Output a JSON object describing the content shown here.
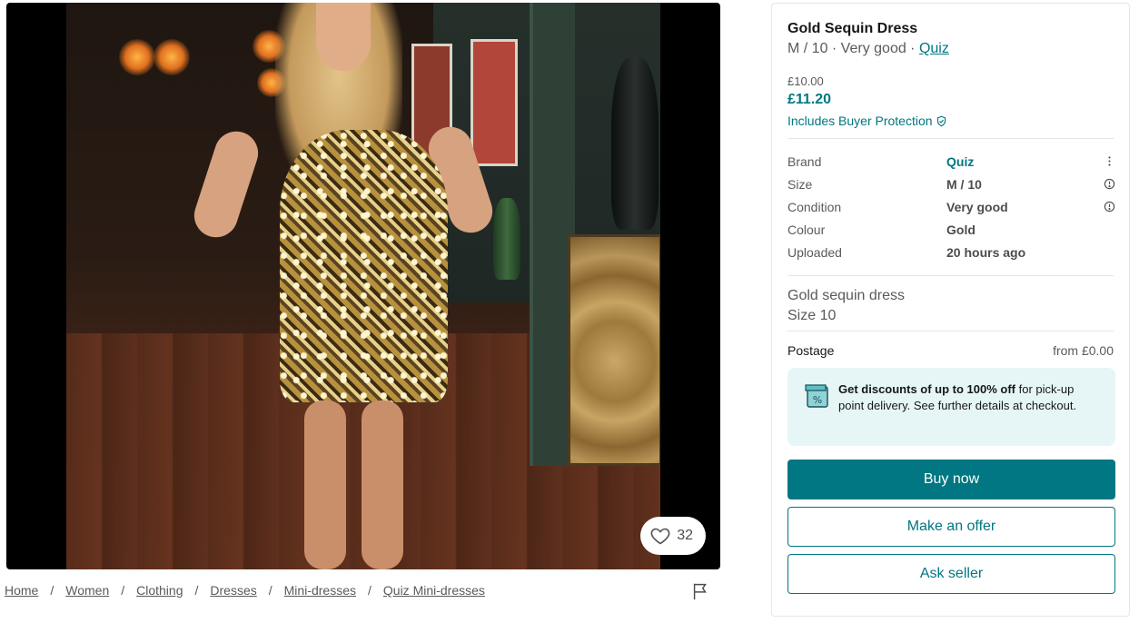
{
  "photo": {
    "like_count": "32"
  },
  "breadcrumb": [
    "Home",
    "Women",
    "Clothing",
    "Dresses",
    "Mini-dresses",
    "Quiz Mini-dresses"
  ],
  "breadcrumb_separator": "/",
  "item": {
    "title": "Gold Sequin Dress",
    "subtitle_prefix": "M / 10 · Very good · ",
    "brand_link": "Quiz",
    "price": "£10.00",
    "price_with_protection": "£11.20",
    "protection_label": "Includes Buyer Protection"
  },
  "details": [
    {
      "label": "Brand",
      "value": "Quiz",
      "icon": "more-vertical-icon"
    },
    {
      "label": "Size",
      "value": "M / 10",
      "icon": "info-icon"
    },
    {
      "label": "Condition",
      "value": "Very good",
      "icon": "info-icon"
    },
    {
      "label": "Colour",
      "value": "Gold"
    },
    {
      "label": "Uploaded",
      "value": "20 hours ago"
    }
  ],
  "description": {
    "line1": "Gold sequin dress",
    "line2": "Size 10"
  },
  "postage": {
    "label": "Postage",
    "value": "from £0.00"
  },
  "promo": {
    "bold": "Get discounts of up to 100% off",
    "rest": " for pick-up point delivery. See further details at checkout."
  },
  "actions": {
    "buy": "Buy now",
    "offer": "Make an offer",
    "ask": "Ask seller"
  },
  "colors": {
    "accent": "#007782",
    "promo_bg": "#e6f6f6"
  }
}
